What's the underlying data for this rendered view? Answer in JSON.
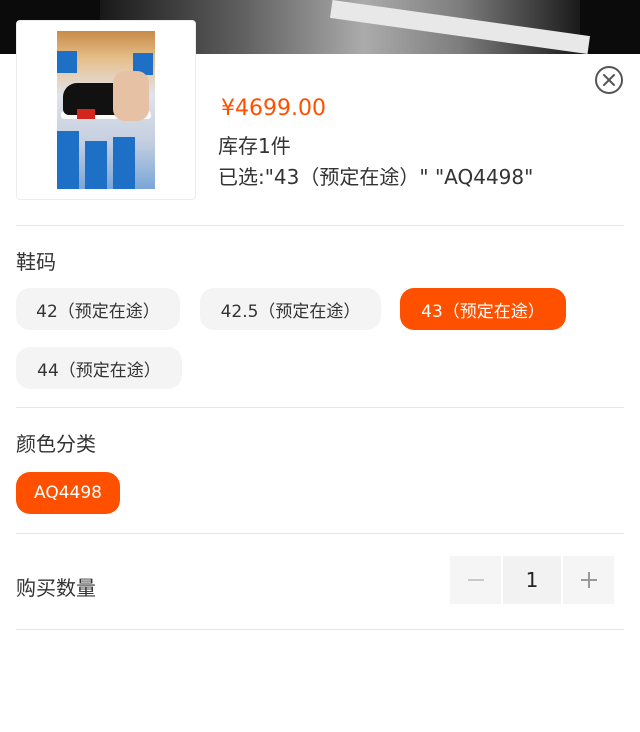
{
  "product": {
    "price": "¥4699.00",
    "stock": "库存1件",
    "selected": "已选:\"43（预定在途）\" \"AQ4498\""
  },
  "size_section": {
    "title": "鞋码",
    "options": [
      "42（预定在途）",
      "42.5（预定在途）",
      "43（预定在途）",
      "44（预定在途）"
    ],
    "selected_index": 2
  },
  "color_section": {
    "title": "颜色分类",
    "options": [
      "AQ4498"
    ],
    "selected_index": 0
  },
  "quantity": {
    "label": "购买数量",
    "value": "1"
  },
  "colors": {
    "accent": "#ff5000",
    "chip_bg": "#f4f4f4"
  },
  "icons": {
    "close": "close-circle-icon",
    "minus": "minus-icon",
    "plus": "plus-icon"
  }
}
